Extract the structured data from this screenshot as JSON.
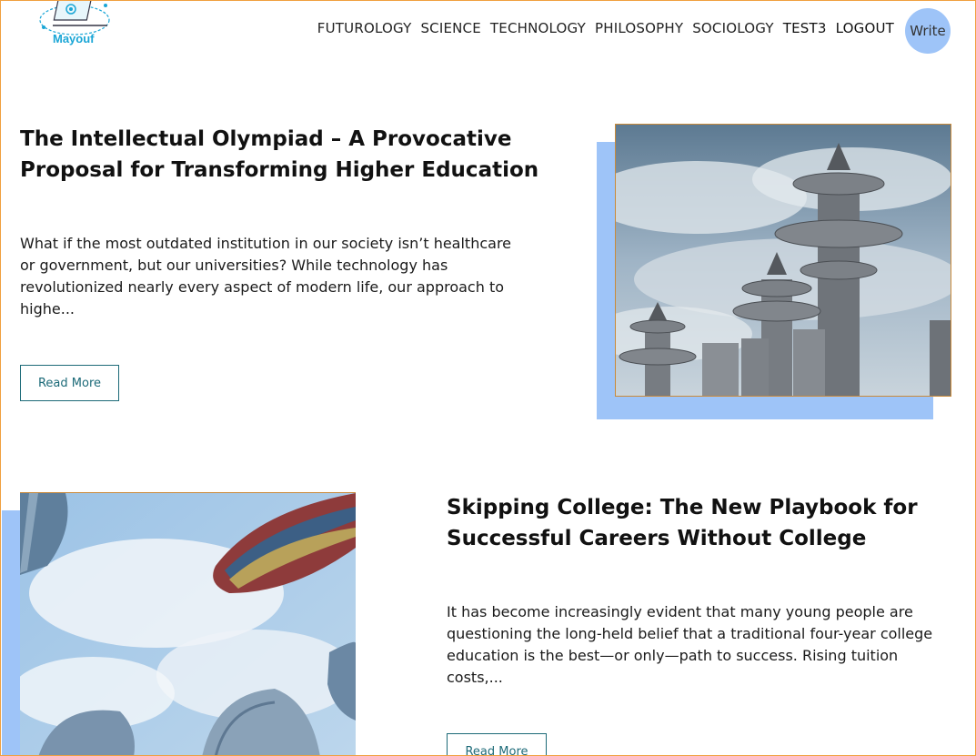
{
  "header": {
    "logo_text": "Mayouf",
    "nav": [
      {
        "label": "FUTUROLOGY"
      },
      {
        "label": "SCIENCE"
      },
      {
        "label": "TECHNOLOGY"
      },
      {
        "label": "PHILOSOPHY"
      },
      {
        "label": "SOCIOLOGY"
      },
      {
        "label": "TEST3"
      },
      {
        "label": "LOGOUT"
      }
    ],
    "write_label": "Write"
  },
  "posts": [
    {
      "title": "The Intellectual Olympiad – A Provocative Proposal for Transforming Higher Education",
      "excerpt": "What if the most outdated institution in our society isn’t healthcare or government, but our universities? While technology has revolutionized nearly every aspect of modern life, our approach to highe...",
      "read_more": "Read More",
      "image_icon": "futuristic-towers-image"
    },
    {
      "title": "Skipping College: The New Playbook for Successful Careers Without College",
      "excerpt": "It has become increasingly evident that many young people are questioning the long-held belief that a traditional four-year college education is the best—or only—path to success. Rising tuition costs,...",
      "read_more": "Read More",
      "image_icon": "skyscrapers-sky-image"
    }
  ],
  "colors": {
    "accent_blue": "#9ec4f8",
    "button_teal": "#1c6a78",
    "logo_blue": "#1aa6d6"
  }
}
